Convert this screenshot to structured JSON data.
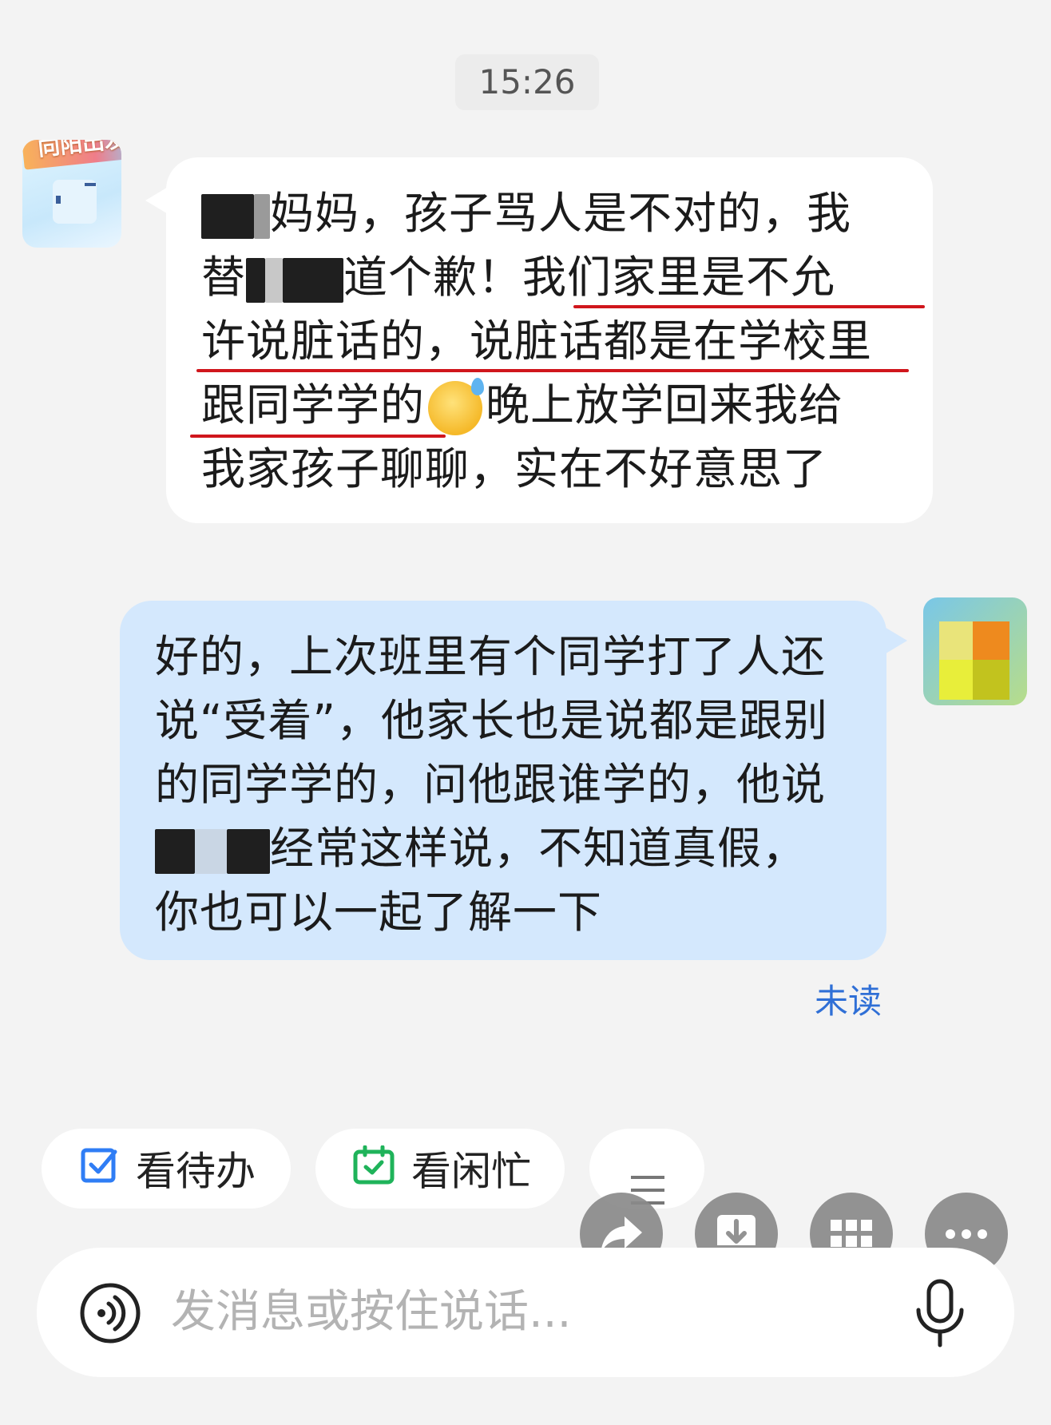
{
  "header": {
    "timestamp": "15:26"
  },
  "contact": {
    "avatar_badge": "向阳出发"
  },
  "incoming_message": {
    "lines": [
      "妈妈，孩子骂人是不对的，我",
      "替",
      "道个歉！我们家里是不允",
      "许说脏话的，说脏话都是在学校里",
      "跟同学学的",
      "晚上放学回来我给",
      "我家孩子聊聊，实在不好意思了"
    ]
  },
  "outgoing_message": {
    "lines": [
      "好的，上次班里有个同学打了人还",
      "说“受着”，他家长也是说都是跟别",
      "的同学学的，问他跟谁学的，他说",
      "经常这样说，不知道真假，",
      "你也可以一起了解一下"
    ],
    "status": "未读"
  },
  "quick_actions": [
    {
      "label": "看待办",
      "icon": "checkbox-icon",
      "color": "#2f7df5"
    },
    {
      "label": "看闲忙",
      "icon": "calendar-check-icon",
      "color": "#1fb35a"
    },
    {
      "label": "",
      "icon": "menu-icon"
    }
  ],
  "floating_actions": [
    "share-icon",
    "download-icon",
    "apps-grid-icon",
    "more-icon"
  ],
  "composer": {
    "placeholder": "发消息或按住说话..."
  },
  "colors": {
    "accent": "#2f6fd6",
    "outgoing_bubble": "#d4e8fd",
    "underline": "#d0161c"
  }
}
